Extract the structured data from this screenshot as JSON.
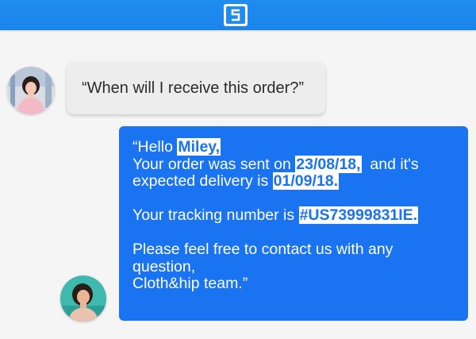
{
  "app": {
    "logo_icon": "brand-s-logo-icon",
    "header_color": "#1f8cf0"
  },
  "customer": {
    "message": "“When will I receive this order?”",
    "avatar_icon": "customer-avatar-photo"
  },
  "agent": {
    "avatar_icon": "agent-avatar-photo",
    "bubble_color": "#1a73f0",
    "greeting": "“Hello ",
    "name": "Miley,",
    "sent_prefix": "Your order was sent on ",
    "sent_date": "23/08/18,",
    "sent_suffix": "  and it's",
    "delivery_prefix": "expected delivery is ",
    "delivery_date": "01/09/18.",
    "tracking_prefix": "Your tracking number is ",
    "tracking_number": "#US73999831IE.",
    "contact_line1": "Please feel free to contact us with any",
    "contact_line2": "question,",
    "signature": "Cloth&hip team.”"
  }
}
